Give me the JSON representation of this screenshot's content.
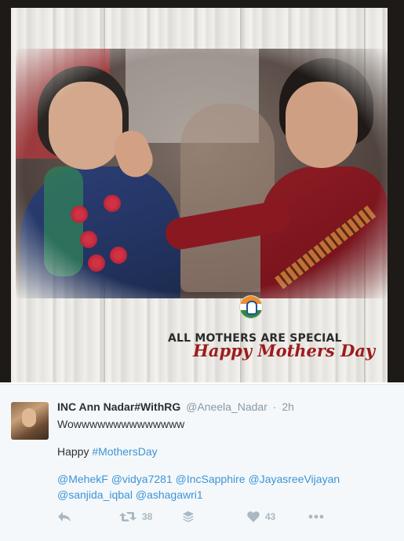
{
  "media": {
    "headline": "ALL MOTHERS ARE SPECIAL",
    "greeting": "Happy Mothers Day"
  },
  "tweet": {
    "display_name": "INC Ann Nadar#WithRG",
    "screen_name": "@Aneela_Nadar",
    "separator": "·",
    "time": "2h",
    "line1": "Wowwwwwwwwwwwwww",
    "line2_prefix": "Happy ",
    "line2_hashtag": "#MothersDay",
    "mentions_row1": [
      "@MehekF",
      "@vidya7281",
      "@IncSapphire",
      "@JayasreeVijayan"
    ],
    "mentions_row2": [
      "@sanjida_iqbal",
      "@ashagawri1"
    ],
    "actions": {
      "retweet_count": "38",
      "like_count": "43"
    }
  },
  "colors": {
    "link": "#3b94d9",
    "greeting": "#9b1c1c",
    "icon": "#aab8c2"
  }
}
